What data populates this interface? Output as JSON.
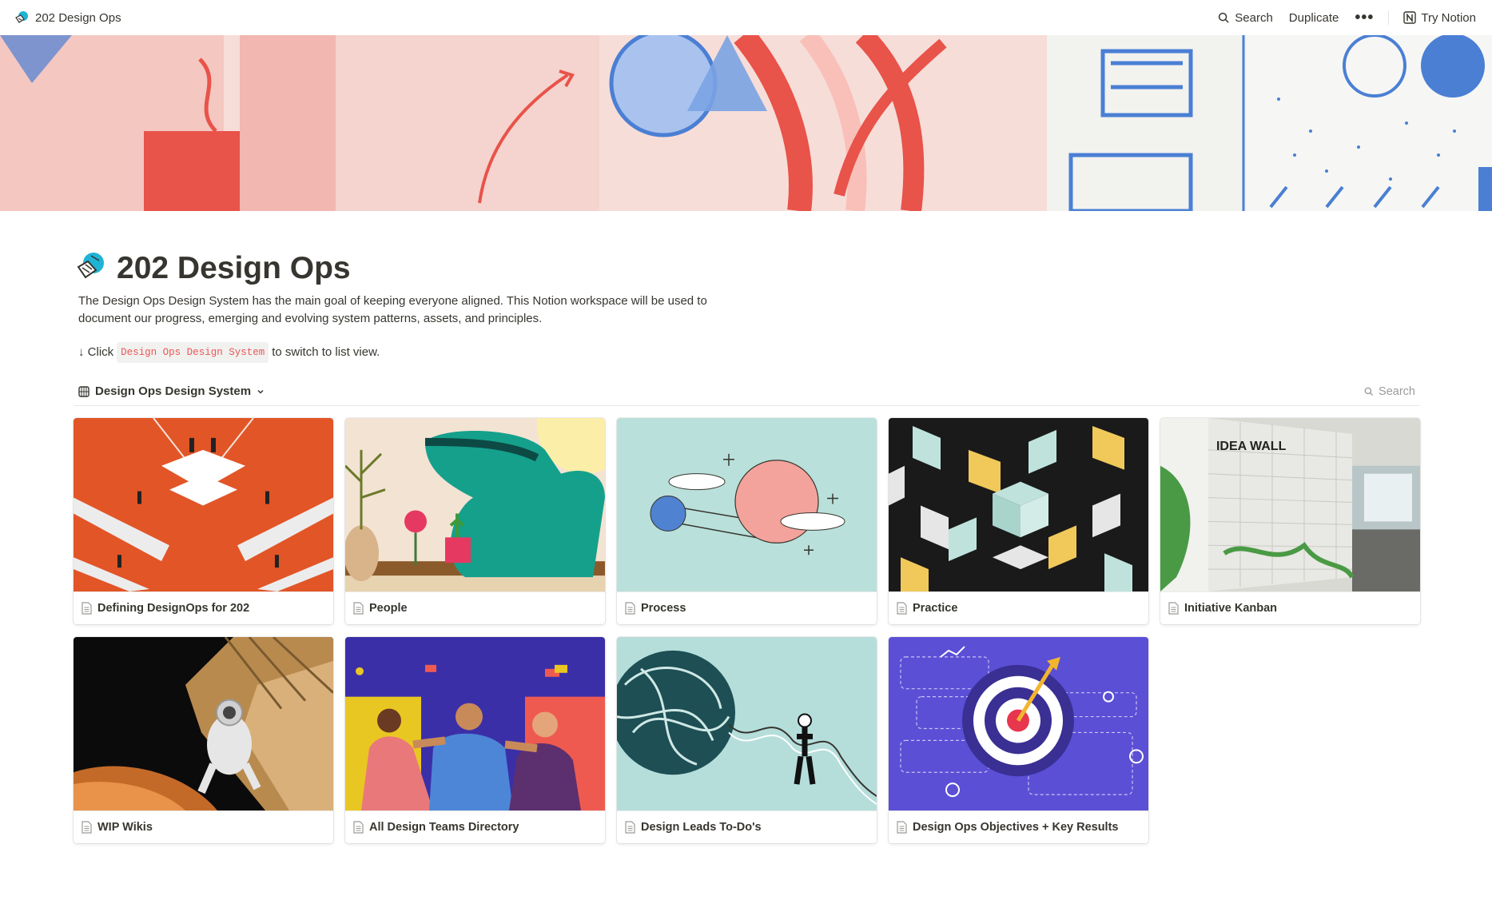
{
  "topbar": {
    "breadcrumb": "202 Design Ops",
    "search_label": "Search",
    "duplicate_label": "Duplicate",
    "more_icon": "more-horizontal-icon",
    "try_notion_label": "Try Notion"
  },
  "page": {
    "title": "202 Design Ops",
    "description": "The Design Ops Design System has the main goal of keeping everyone aligned. This Notion workspace will be used to document our progress, emerging and evolving system patterns, assets, and principles.",
    "click_prefix": "↓ Click",
    "click_code": "Design Ops Design System",
    "click_suffix": "to switch to list view."
  },
  "database": {
    "title": "Design Ops Design System",
    "search_placeholder": "Search",
    "cards": [
      {
        "title": "Defining DesignOps for 202"
      },
      {
        "title": "People"
      },
      {
        "title": "Process"
      },
      {
        "title": "Practice"
      },
      {
        "title": "Initiative Kanban"
      },
      {
        "title": "WIP Wikis"
      },
      {
        "title": "All Design Teams Directory"
      },
      {
        "title": "Design Leads To-Do's"
      },
      {
        "title": "Design Ops Objectives + Key Results"
      }
    ]
  },
  "colors": {
    "accent_red": "#eb5757",
    "cover_red": "#e8534a",
    "cover_blue": "#4a7fd4",
    "text": "#37352f",
    "muted": "#9b9a97"
  }
}
